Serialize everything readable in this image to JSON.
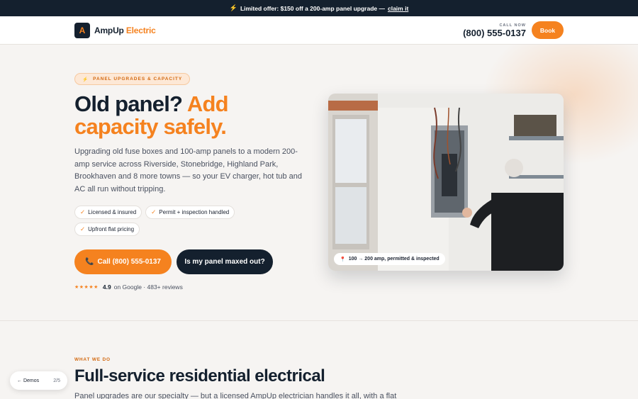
{
  "promo": {
    "icon": "bolt-icon",
    "text": "Limited offer: $150 off a 200-amp panel upgrade —",
    "link": "claim it"
  },
  "header": {
    "logo_mark": "A",
    "logo_main": "AmpUp",
    "logo_accent": "Electric",
    "call_label": "CALL NOW",
    "call_number": "(800) 555-0137",
    "book_label": "Book"
  },
  "hero": {
    "eyebrow": "PANEL UPGRADES & CAPACITY",
    "headline_main": "Old panel?",
    "headline_accent": "Add capacity safely.",
    "lead": "Upgrading old fuse boxes and 100-amp panels to a modern 200-amp service across Riverside, Stonebridge, Highland Park, Brookhaven and 8 more towns — so your EV charger, hot tub and AC all run without tripping.",
    "chips": [
      "Licensed & insured",
      "Permit + inspection handled",
      "Upfront flat pricing"
    ],
    "cta_call": "Call (800) 555-0137",
    "cta_check": "Is my panel maxed out?",
    "rating": {
      "stars": "★★★★★",
      "score": "4.9",
      "source": "on Google · 483+ reviews"
    },
    "photo_badge": "100 → 200 amp, permitted & inspected"
  },
  "services": {
    "eyebrow": "WHAT WE DO",
    "title": "Full-service residential electrical",
    "description": "Panel upgrades are our specialty — but a licensed AmpUp electrician handles it all, with a flat"
  },
  "demo_nav": {
    "back_label": "← Demos",
    "count": "2/5"
  },
  "colors": {
    "accent": "#f5821f",
    "navy": "#14202e",
    "background": "#f6f4f2"
  }
}
